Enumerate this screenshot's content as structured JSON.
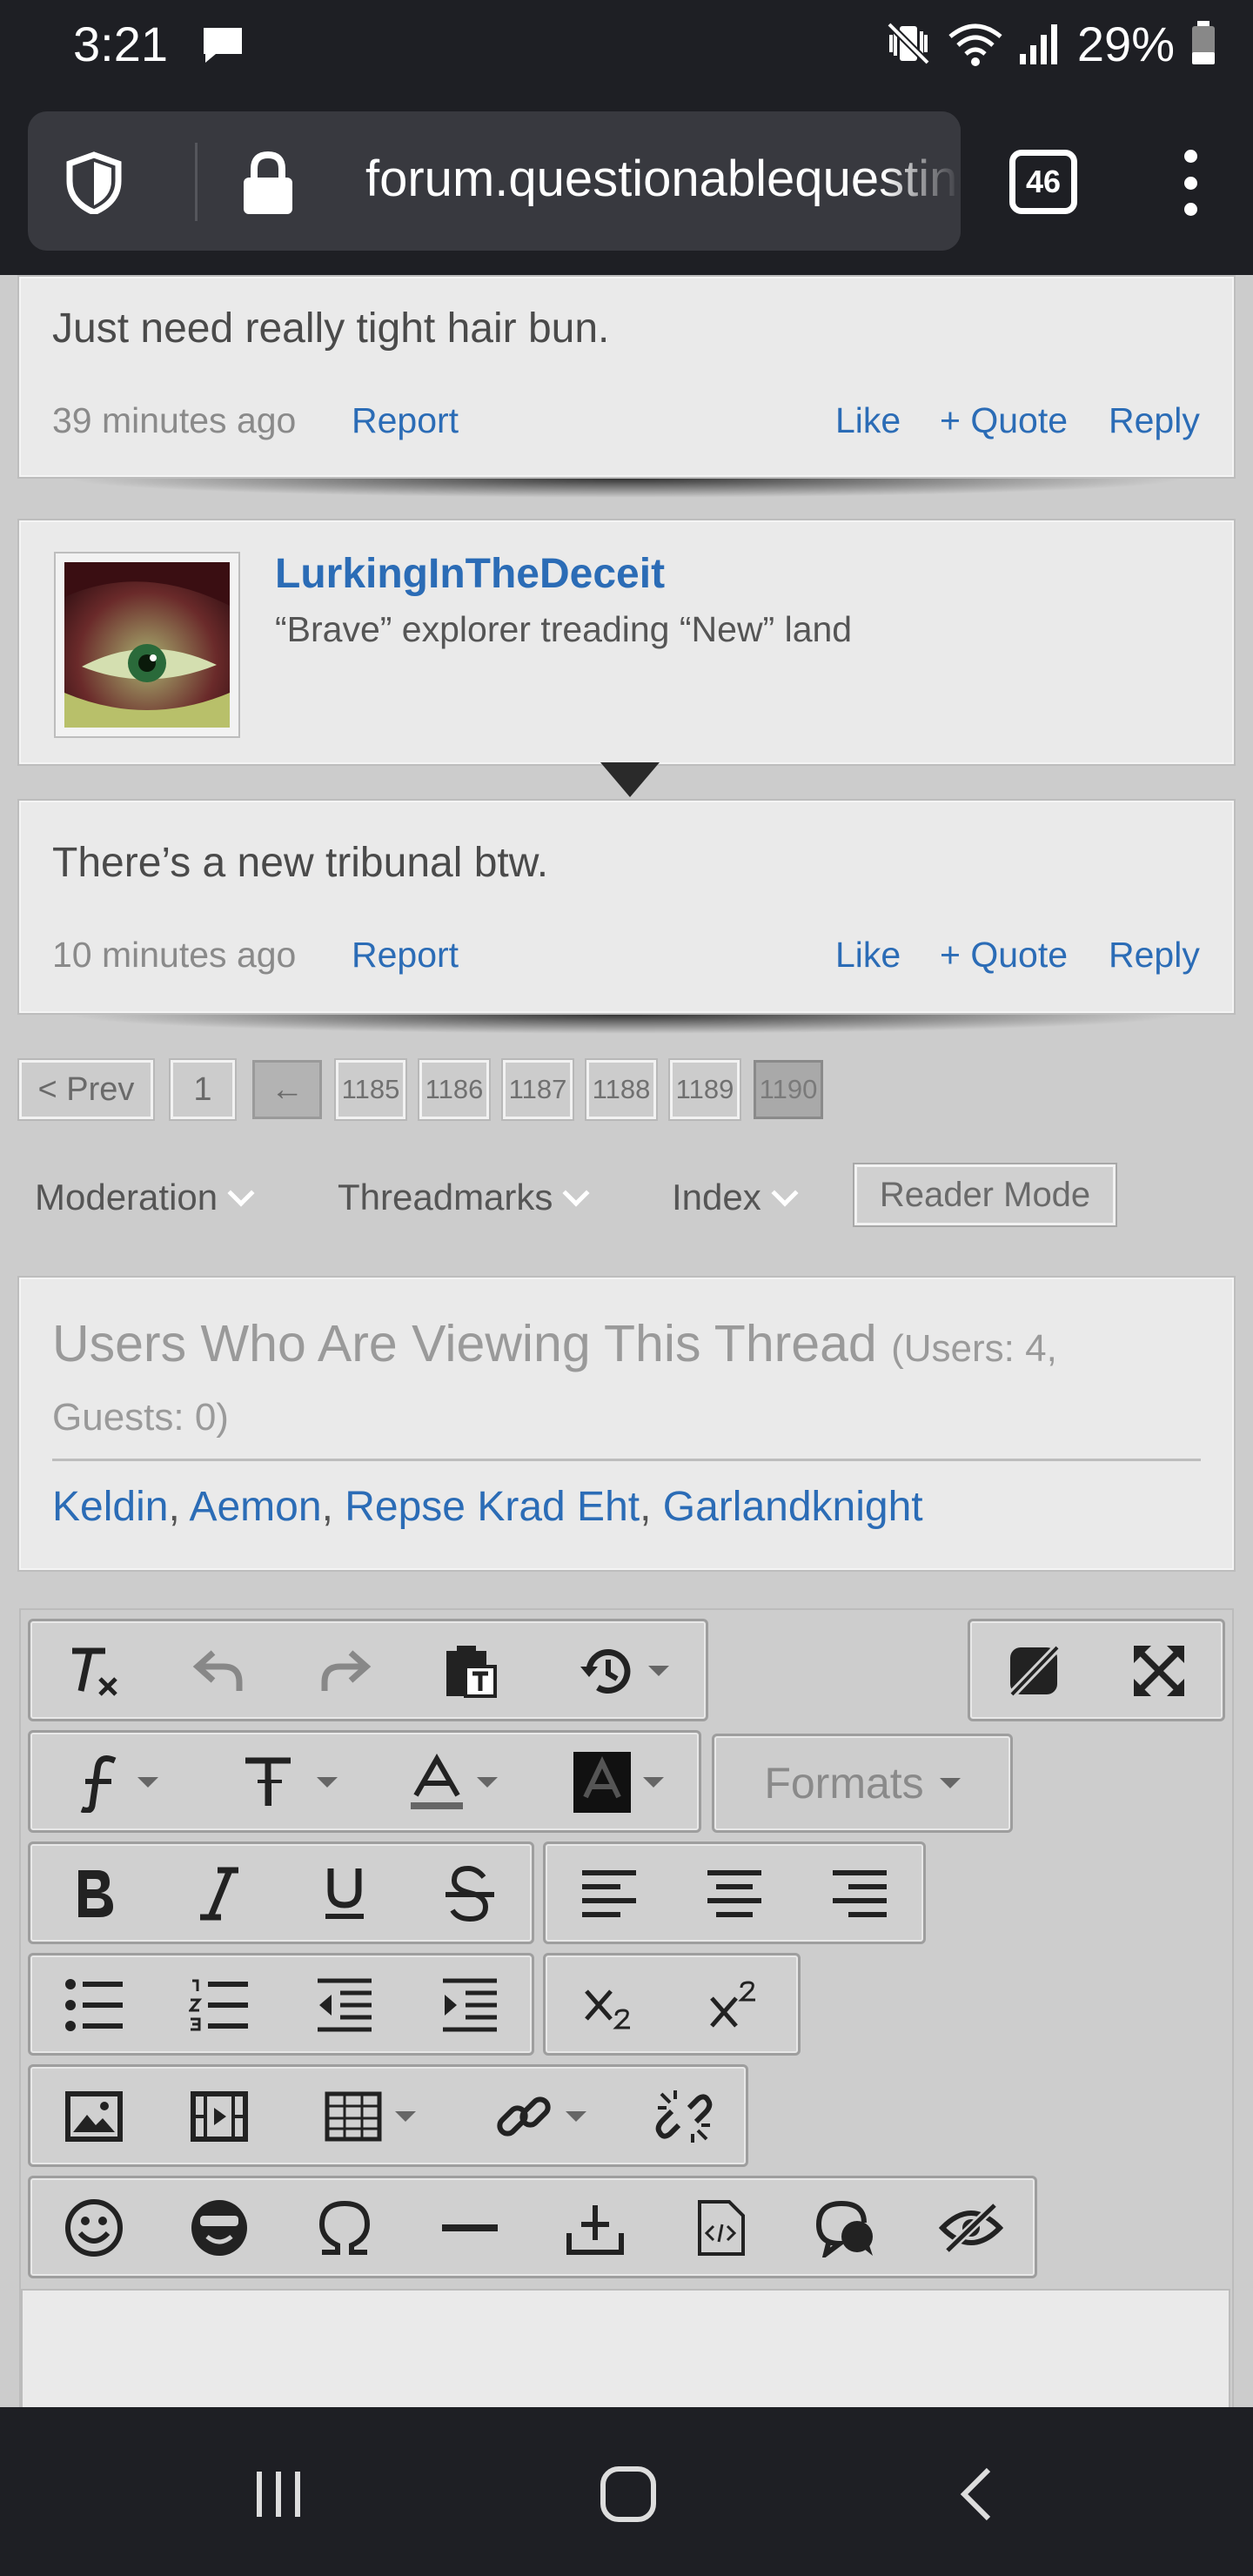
{
  "status_bar": {
    "time": "3:21",
    "battery_percent": "29%"
  },
  "browser": {
    "url": "forum.questionablequesting.com",
    "tab_count": "46"
  },
  "posts": [
    {
      "text": "Just need really tight hair bun.",
      "time": "39 minutes ago",
      "report": "Report",
      "like": "Like",
      "quote": "+ Quote",
      "reply": "Reply"
    },
    {
      "username": "LurkingInTheDeceit",
      "user_title": "“Brave” explorer treading “New” land",
      "text": "There’s a new tribunal btw.",
      "time": "10 minutes ago",
      "report": "Report",
      "like": "Like",
      "quote": "+ Quote",
      "reply": "Reply"
    }
  ],
  "pagination": {
    "prev": "< Prev",
    "first": "1",
    "back_arrow": "←",
    "pages": [
      "1185",
      "1186",
      "1187",
      "1188",
      "1189",
      "1190"
    ],
    "current": "1190"
  },
  "thread_tools": {
    "moderation": "Moderation",
    "threadmarks": "Threadmarks",
    "index": "Index",
    "reader_mode": "Reader Mode"
  },
  "viewers": {
    "title": "Users Who Are Viewing This Thread",
    "count_part1": "(Users: 4,",
    "count_part2": "Guests: 0)",
    "users": [
      "Keldin",
      "Aemon",
      "Repse Krad Eht",
      "Garlandknight"
    ],
    "separator": ", "
  },
  "editor": {
    "formats_label": "Formats",
    "toolbar_icons": [
      "remove-format-icon",
      "undo-icon",
      "redo-icon",
      "paste-text-icon",
      "restore-draft-icon",
      "toggle-bbcode-icon",
      "fullscreen-icon",
      "font-family-icon",
      "font-size-icon",
      "text-color-icon",
      "background-color-icon",
      "bold-icon",
      "italic-icon",
      "underline-icon",
      "strikethrough-icon",
      "align-left-icon",
      "align-center-icon",
      "align-right-icon",
      "bullet-list-icon",
      "numbered-list-icon",
      "outdent-icon",
      "indent-icon",
      "subscript-icon",
      "superscript-icon",
      "image-icon",
      "media-icon",
      "table-icon",
      "link-icon",
      "unlink-icon",
      "smilie-icon",
      "smilie-alt-icon",
      "special-character-icon",
      "horizontal-rule-icon",
      "insert-icon",
      "code-icon",
      "quote-icon",
      "spoiler-icon"
    ]
  },
  "colors": {
    "link": "#2b6cb6",
    "chrome": "#1e1f24",
    "page_bg": "#cccccc",
    "card_bg": "#eaeaea"
  }
}
